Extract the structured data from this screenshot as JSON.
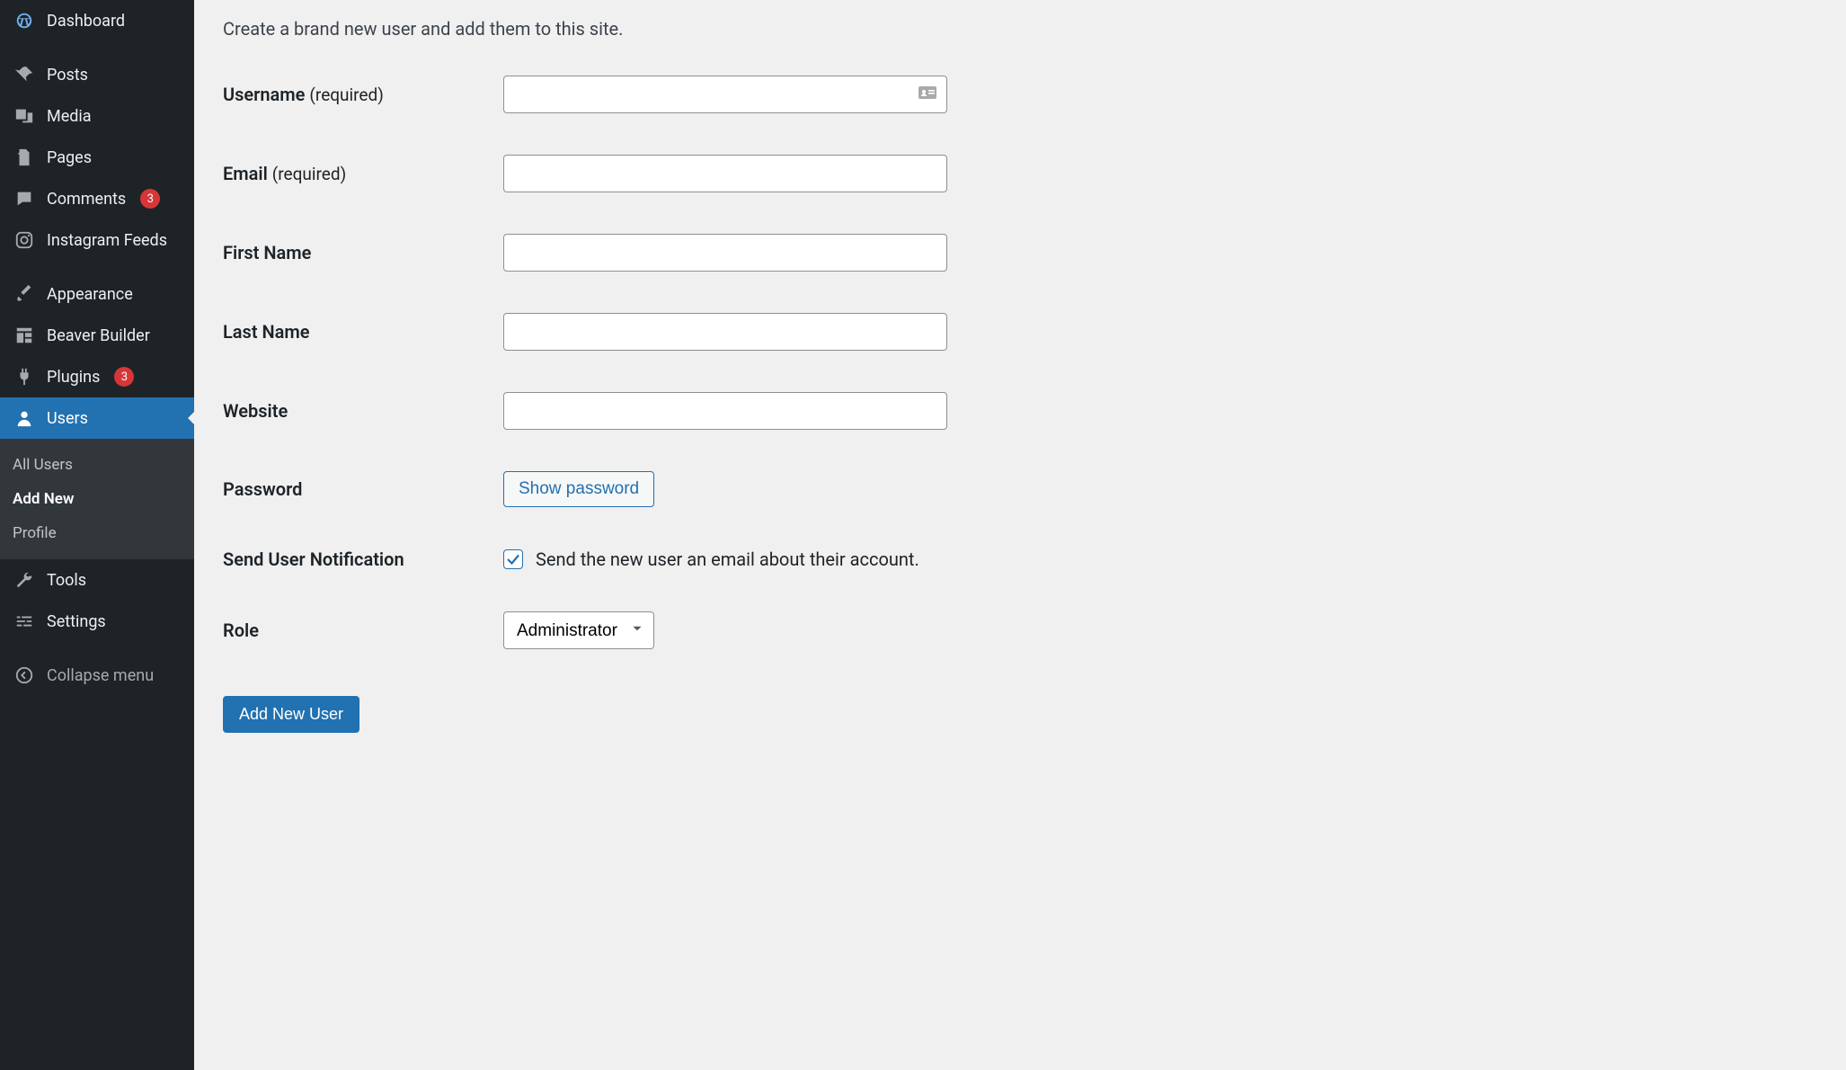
{
  "sidebar": {
    "dashboard": "Dashboard",
    "posts": "Posts",
    "media": "Media",
    "pages": "Pages",
    "comments": "Comments",
    "comments_count": "3",
    "instagram": "Instagram Feeds",
    "appearance": "Appearance",
    "beaver": "Beaver Builder",
    "plugins": "Plugins",
    "plugins_count": "3",
    "users": "Users",
    "users_sub": {
      "all": "All Users",
      "add": "Add New",
      "profile": "Profile"
    },
    "tools": "Tools",
    "settings": "Settings",
    "collapse": "Collapse menu"
  },
  "page": {
    "intro": "Create a brand new user and add them to this site.",
    "labels": {
      "username": "Username",
      "email": "Email",
      "first": "First Name",
      "last": "Last Name",
      "website": "Website",
      "password": "Password",
      "notify": "Send User Notification",
      "role": "Role",
      "required": "(required)"
    },
    "show_password": "Show password",
    "notify_check_label": "Send the new user an email about their account.",
    "role_value": "Administrator",
    "submit": "Add New User"
  }
}
